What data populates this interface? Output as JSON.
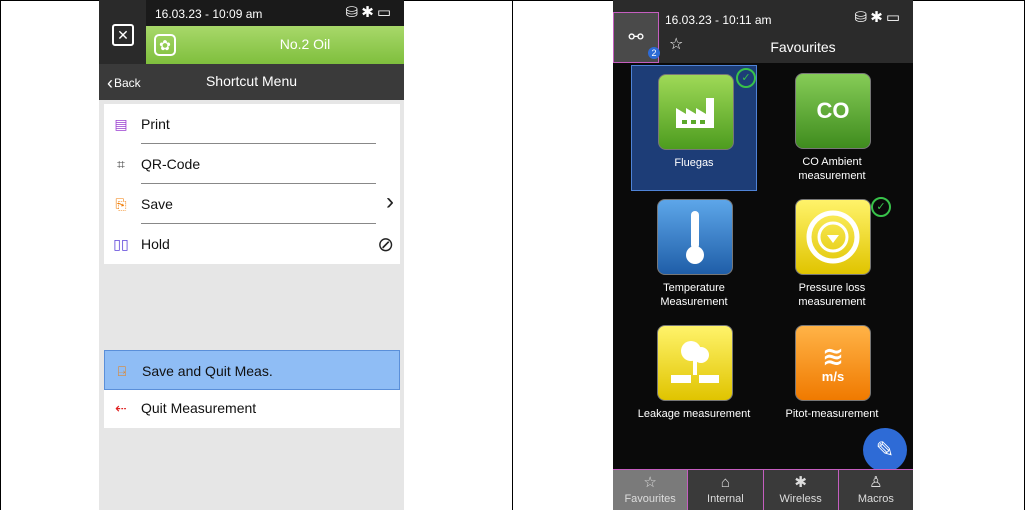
{
  "left": {
    "status": {
      "time": "16.03.23 - 10:09 am"
    },
    "title": "No.2 Oil",
    "nav": {
      "back": "Back",
      "title": "Shortcut Menu"
    },
    "items": [
      {
        "label": "Print",
        "icon": "printer-icon",
        "color": "#9b3fd0"
      },
      {
        "label": "QR-Code",
        "icon": "qr-code-icon",
        "color": "#444444"
      },
      {
        "label": "Save",
        "icon": "save-icon",
        "color": "#f07a00"
      },
      {
        "label": "Hold",
        "icon": "pause-icon",
        "color": "#5a3fd9"
      }
    ],
    "bottom_items": [
      {
        "label": "Save and Quit Meas.",
        "icon": "save-quit-icon",
        "color": "#f07a00"
      },
      {
        "label": "Quit Measurement",
        "icon": "exit-icon",
        "color": "#e02020"
      }
    ]
  },
  "right": {
    "status": {
      "time": "16.03.23 - 10:11 am"
    },
    "badge": "2",
    "title": "Favourites",
    "tiles": [
      {
        "label": "Fluegas",
        "icon_text": ""
      },
      {
        "label": "CO Ambient measurement",
        "icon_text": "CO"
      },
      {
        "label": "Temperature Measurement",
        "icon_text": ""
      },
      {
        "label": "Pressure loss measurement",
        "icon_text": ""
      },
      {
        "label": "Leakage measurement",
        "icon_text": ""
      },
      {
        "label": "Pitot-measurement",
        "icon_text": "m/s"
      }
    ],
    "tabs": [
      {
        "label": "Favourites",
        "icon": "star-icon"
      },
      {
        "label": "Internal",
        "icon": "home-icon"
      },
      {
        "label": "Wireless",
        "icon": "bluetooth-icon"
      },
      {
        "label": "Macros",
        "icon": "user-icon"
      }
    ]
  }
}
